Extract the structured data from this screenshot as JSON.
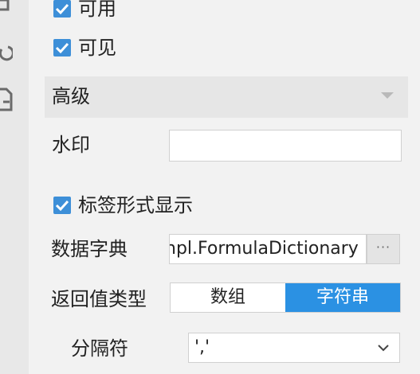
{
  "icons": {
    "strip": [
      "link-icon",
      "refresh-icon",
      "document-icon"
    ],
    "check": "checkmark-icon",
    "more": "ellipsis-icon",
    "dropdown": "chevron-down-icon",
    "section": "caret-down-icon"
  },
  "colors": {
    "checkbox": "#3d8fd8",
    "segment_active": "#2b91e3",
    "panel_bg": "#f2f2f2",
    "section_bg": "#e6e6e6"
  },
  "checkboxes": {
    "enabled": {
      "label": "可用",
      "checked": true
    },
    "visible": {
      "label": "可见",
      "checked": true
    },
    "label_display": {
      "label": "标签形式显示",
      "checked": true
    }
  },
  "advanced": {
    "title": "高级"
  },
  "watermark": {
    "label": "水印",
    "value": ""
  },
  "dictionary": {
    "label": "数据字典",
    "value": "npl.FormulaDictionary",
    "more_button": "···"
  },
  "return_type": {
    "label": "返回值类型",
    "options": [
      "数组",
      "字符串"
    ],
    "selected": "字符串"
  },
  "separator": {
    "label": "分隔符",
    "value": "','"
  }
}
